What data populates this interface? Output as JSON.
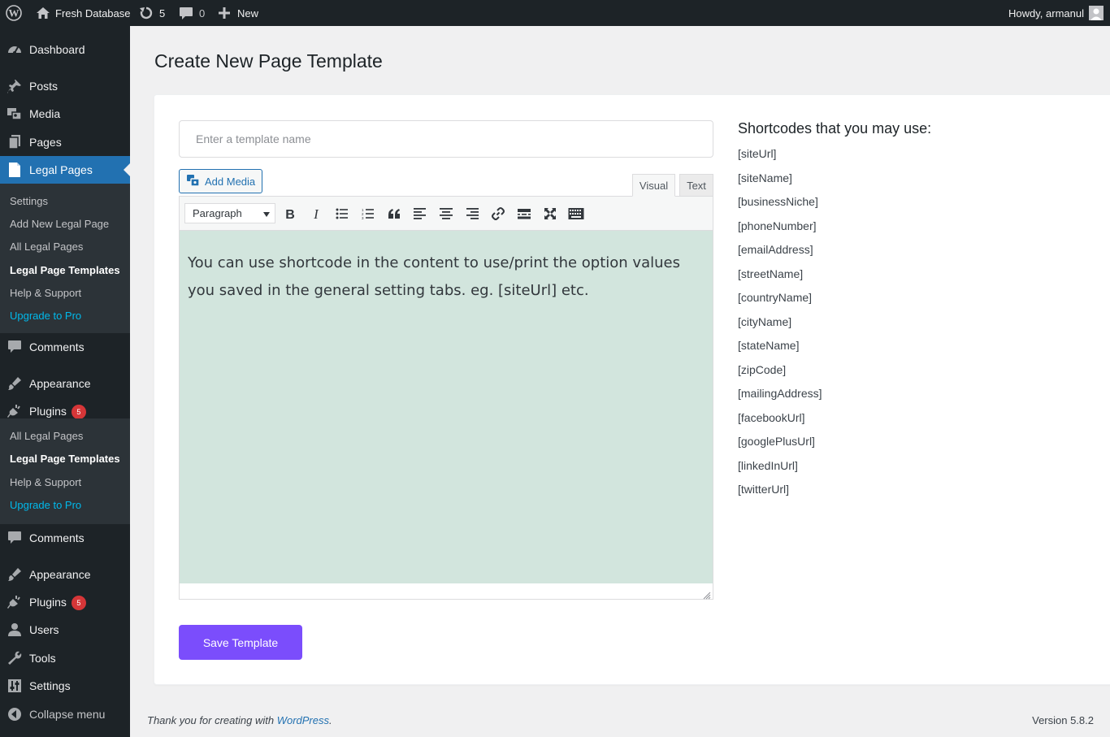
{
  "adminbar": {
    "site_name": "Fresh Database",
    "updates_count": "5",
    "comments_count": "0",
    "new_label": "New",
    "howdy": "Howdy, armanul"
  },
  "sidebar": {
    "menu_top": [
      {
        "label": "Dashboard",
        "icon": "dashboard-icon"
      },
      {
        "label": "Posts",
        "icon": "pin-icon"
      },
      {
        "label": "Media",
        "icon": "media-icon"
      },
      {
        "label": "Pages",
        "icon": "pages-icon"
      },
      {
        "label": "Legal Pages",
        "icon": "legal-page-icon"
      }
    ],
    "submenu1": [
      "Settings",
      "Add New Legal Page",
      "All Legal Pages",
      "Legal Page Templates",
      "Help & Support",
      "Upgrade to Pro"
    ],
    "menu_mid": [
      {
        "label": "Comments",
        "icon": "comment-icon"
      },
      {
        "label": "Appearance",
        "icon": "brush-icon"
      },
      {
        "label": "Plugins",
        "icon": "plugin-icon",
        "badge": "5"
      }
    ],
    "submenu2": [
      "All Legal Pages",
      "Legal Page Templates",
      "Help & Support",
      "Upgrade to Pro"
    ],
    "menu_bottom": [
      {
        "label": "Comments",
        "icon": "comment-icon"
      },
      {
        "label": "Appearance",
        "icon": "brush-icon"
      },
      {
        "label": "Plugins",
        "icon": "plugin-icon",
        "badge": "5"
      },
      {
        "label": "Users",
        "icon": "user-icon"
      },
      {
        "label": "Tools",
        "icon": "wrench-icon"
      },
      {
        "label": "Settings",
        "icon": "sliders-icon"
      },
      {
        "label": "Collapse menu",
        "icon": "collapse-icon"
      }
    ]
  },
  "page": {
    "title": "Create New Page Template",
    "template_name_placeholder": "Enter a template name",
    "template_name_value": "",
    "add_media_label": "Add Media",
    "tab_visual": "Visual",
    "tab_text": "Text",
    "format_select": "Paragraph",
    "content": "You can use shortcode in the content to use/print the option values you saved in the general setting tabs. eg. [siteUrl] etc.",
    "save_label": "Save Template"
  },
  "shortcodes": {
    "heading": "Shortcodes that you may use:",
    "items": [
      "[siteUrl]",
      "[siteName]",
      "[businessNiche]",
      "[phoneNumber]",
      "[emailAddress]",
      "[streetName]",
      "[countryName]",
      "[cityName]",
      "[stateName]",
      "[zipCode]",
      "[mailingAddress]",
      "[facebookUrl]",
      "[googlePlusUrl]",
      "[linkedInUrl]",
      "[twitterUrl]"
    ]
  },
  "footer": {
    "thanks_prefix": "Thank you for creating with ",
    "wordpress_link": "WordPress",
    "thanks_suffix": ".",
    "version": "Version 5.8.2"
  },
  "colors": {
    "adminbar_bg": "#1d2327",
    "active_menu": "#2271b1",
    "editor_bg": "#d2e5dd",
    "save_button": "#7b4dfc",
    "upgrade_link": "#00b9eb"
  }
}
